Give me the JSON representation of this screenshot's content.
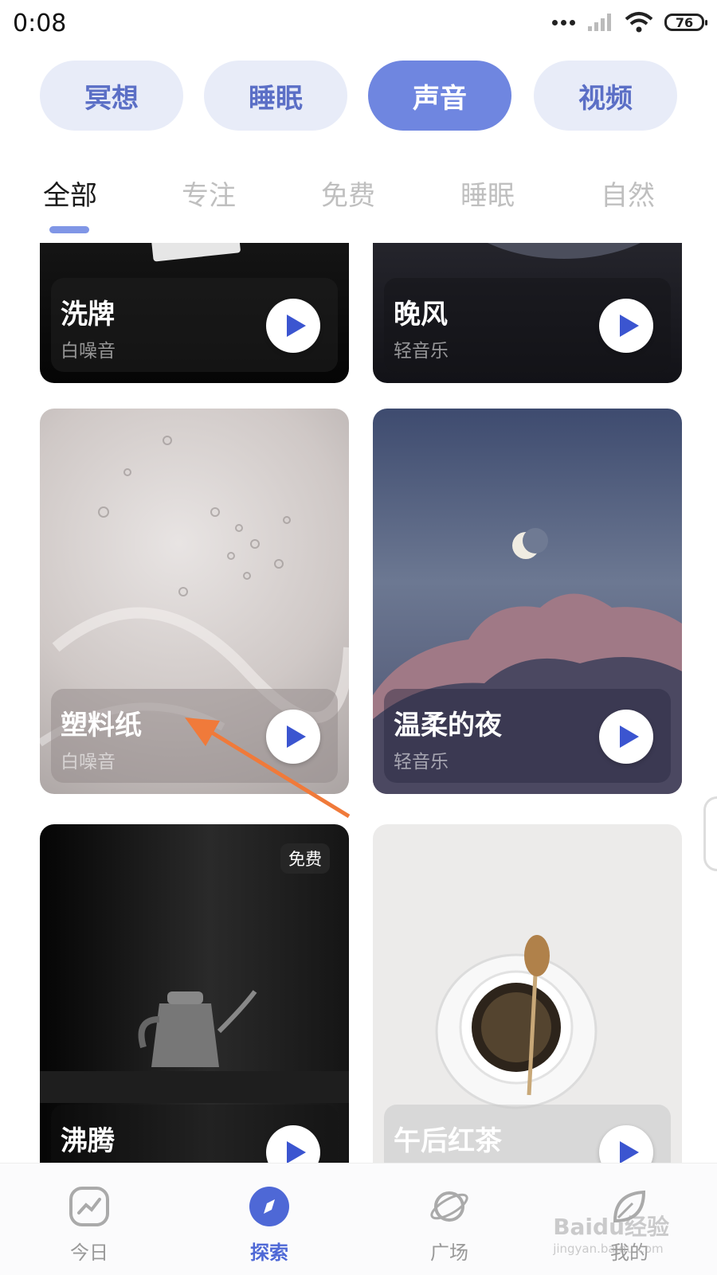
{
  "status": {
    "time": "0:08",
    "battery": "76"
  },
  "pills": [
    {
      "label": "冥想"
    },
    {
      "label": "睡眠"
    },
    {
      "label": "声音"
    },
    {
      "label": "视频"
    }
  ],
  "tabs": [
    {
      "label": "全部"
    },
    {
      "label": "专注"
    },
    {
      "label": "免费"
    },
    {
      "label": "睡眠"
    },
    {
      "label": "自然"
    }
  ],
  "cards": [
    {
      "title": "洗牌",
      "subtitle": "白噪音"
    },
    {
      "title": "晚风",
      "subtitle": "轻音乐"
    },
    {
      "title": "塑料纸",
      "subtitle": "白噪音"
    },
    {
      "title": "温柔的夜",
      "subtitle": "轻音乐"
    },
    {
      "title": "沸腾",
      "subtitle": "",
      "badge": "免费"
    },
    {
      "title": "午后红茶",
      "subtitle": ""
    }
  ],
  "nav": [
    {
      "label": "今日"
    },
    {
      "label": "探索"
    },
    {
      "label": "广场"
    },
    {
      "label": "我的"
    }
  ],
  "watermark": {
    "line1": "Baidu经验",
    "line2": "jingyan.baidu.com"
  },
  "colors": {
    "accent": "#6f86e0",
    "pill_bg": "#e8ecf8",
    "play_icon": "#3b55d0",
    "annotation_arrow": "#f07a3a"
  }
}
